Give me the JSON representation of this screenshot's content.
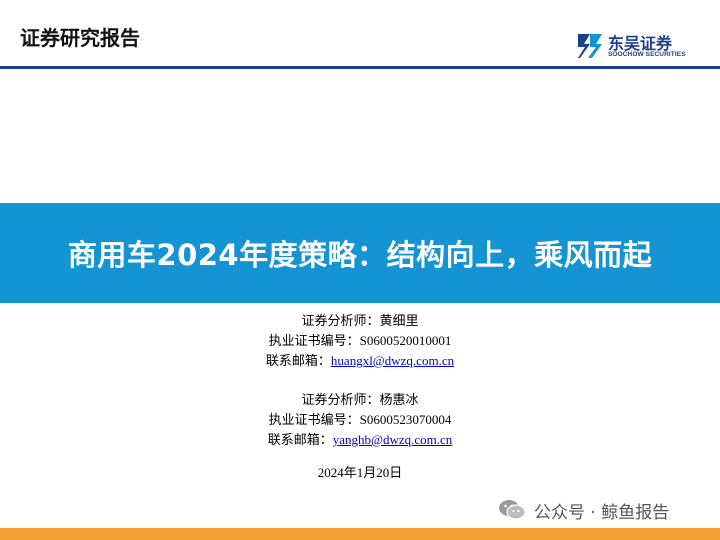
{
  "header": {
    "title": "证券研究报告",
    "logo_cn": "东吴证券",
    "logo_en": "SOOCHOW SECURITIES"
  },
  "banner": {
    "title": "商用车2024年度策略：结构向上，乘风而起"
  },
  "analysts": [
    {
      "role_label": "证券分析师：",
      "name": "黄细里",
      "cert_label": "执业证书编号：",
      "cert_no": "S0600520010001",
      "email_label": "联系邮箱：",
      "email": "huangxl@dwzq.com.cn"
    },
    {
      "role_label": "证券分析师：",
      "name": "杨惠冰",
      "cert_label": "执业证书编号：",
      "cert_no": "S0600523070004",
      "email_label": "联系邮箱：",
      "email": "yanghb@dwzq.com.cn"
    }
  ],
  "date": "2024年1月20日",
  "watermark": {
    "text": "公众号 · 鲸鱼报告",
    "icon": "wechat-icon"
  },
  "colors": {
    "brand_blue": "#1b3f8b",
    "banner_blue": "#1594d4",
    "footer_orange": "#f5a033",
    "link_blue": "#0000cc"
  }
}
